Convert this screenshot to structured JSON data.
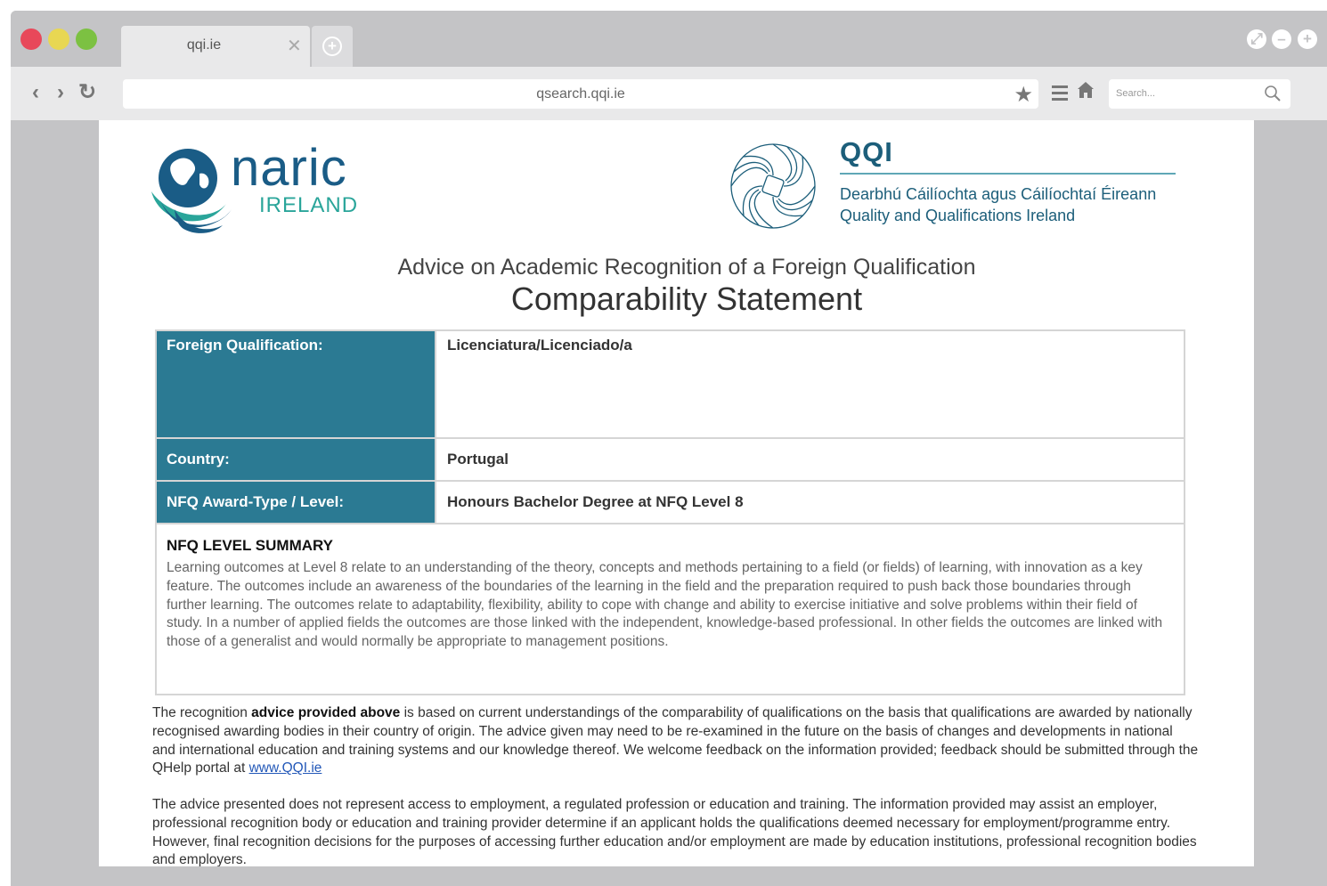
{
  "browser": {
    "tab_title": "qqi.ie",
    "tab_close": "✕",
    "new_tab": "+",
    "url": "qsearch.qqi.ie",
    "search_placeholder": "Search...",
    "nav_back": "‹",
    "nav_forward": "›",
    "reload": "↻",
    "window_buttons": [
      "⤢",
      "–",
      "+"
    ],
    "colors": {
      "close": "#e8485a",
      "minimize": "#e8d752",
      "maximize": "#7cc142",
      "chrome": "#c4c4c6"
    }
  },
  "page": {
    "naric_logo": {
      "word": "naric",
      "sub": "IRELAND"
    },
    "qqi_logo": {
      "title": "QQI",
      "subtitle_irish": "Dearbhú Cáilíochta agus Cáilíochtaí Éireann",
      "subtitle_english": "Quality and Qualifications Ireland"
    },
    "heading": "Advice on Academic Recognition of a Foreign Qualification",
    "title": "Comparability Statement",
    "table": {
      "rows": [
        {
          "label": "Foreign Qualification:",
          "value": "Licenciatura/Licenciado/a"
        },
        {
          "label": "Country:",
          "value": "Portugal"
        },
        {
          "label": "NFQ Award-Type / Level:",
          "value": "Honours Bachelor Degree at NFQ Level 8"
        }
      ],
      "summary_title": "NFQ LEVEL SUMMARY",
      "summary_text": "Learning outcomes at Level 8 relate to an understanding of the theory, concepts and methods pertaining to a field (or fields) of learning, with innovation as a key feature. The outcomes include an awareness of the boundaries of the learning in the field and the preparation required to push back those boundaries through further learning. The outcomes relate to adaptability, flexibility, ability to cope with change and ability to exercise initiative and solve problems within their field of study. In a number of applied fields the outcomes are those linked with the independent, knowledge-based professional. In other fields the outcomes are linked with those of a generalist and would normally be appropriate to management positions.",
      "label_color": "#2b7a93"
    },
    "para1": {
      "before": "The recognition ",
      "bold": "advice provided above",
      "after": " is based on current understandings of the comparability of qualifications on the basis that qualifications are awarded by nationally recognised awarding bodies in their country of origin. The advice given may need to be re-examined in the future on the basis of changes and developments in national and international education and training systems and our knowledge thereof. We welcome feedback on the information provided; feedback should be submitted through the QHelp portal at ",
      "link": "www.QQI.ie"
    },
    "para2": "The advice presented does not represent access to employment, a regulated profession or education and training. The information provided may assist an employer, professional recognition body or education and training provider determine if an applicant holds the qualifications deemed necessary for employment/programme entry. However, final recognition decisions for the purposes of accessing further education and/or employment are made by education institutions, professional recognition bodies and employers."
  }
}
